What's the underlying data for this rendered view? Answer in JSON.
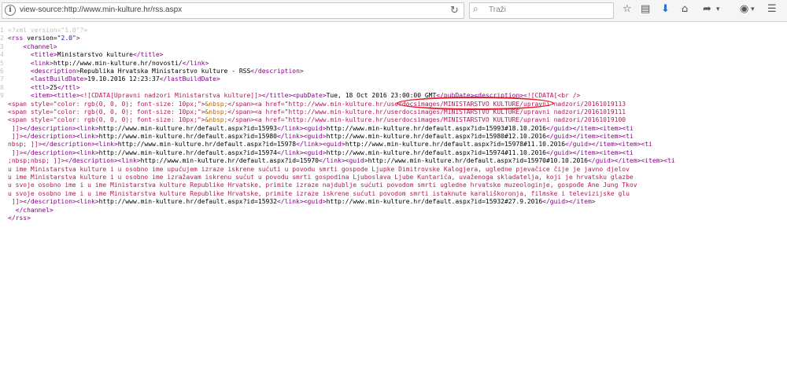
{
  "toolbar": {
    "url": "view-source:http://www.min-kulture.hr/rss.aspx",
    "search_placeholder": "Traži"
  },
  "source_lines": [
    [
      {
        "c": "pi",
        "t": "<?xml version=\"1.0\"?>"
      }
    ],
    [
      {
        "c": "tag",
        "t": "<rss "
      },
      {
        "c": "attr",
        "t": "version="
      },
      {
        "c": "av",
        "t": "\"2.0\""
      },
      {
        "c": "tag",
        "t": ">"
      }
    ],
    [
      {
        "c": "txt",
        "t": "    "
      },
      {
        "c": "tag",
        "t": "<channel>"
      }
    ],
    [
      {
        "c": "txt",
        "t": "      "
      },
      {
        "c": "tag",
        "t": "<title>"
      },
      {
        "c": "txt",
        "t": "Ministarstvo kulture"
      },
      {
        "c": "tag",
        "t": "</title>"
      }
    ],
    [
      {
        "c": "txt",
        "t": "      "
      },
      {
        "c": "tag",
        "t": "<link>"
      },
      {
        "c": "txt",
        "t": "http://www.min-kulture.hr/novosti/"
      },
      {
        "c": "tag",
        "t": "</link>"
      }
    ],
    [
      {
        "c": "txt",
        "t": "      "
      },
      {
        "c": "tag",
        "t": "<description>"
      },
      {
        "c": "txt",
        "t": "Republika Hrvatska Ministarstvo kulture - RSS"
      },
      {
        "c": "tag",
        "t": "</description>"
      }
    ],
    [
      {
        "c": "txt",
        "t": "      "
      },
      {
        "c": "tag",
        "t": "<lastBuildDate>"
      },
      {
        "c": "txt",
        "t": "19.10.2016 12:23:37"
      },
      {
        "c": "tag",
        "t": "</lastBuildDate>"
      }
    ],
    [
      {
        "c": "txt",
        "t": "      "
      },
      {
        "c": "tag",
        "t": "<ttl>"
      },
      {
        "c": "txt",
        "t": "25"
      },
      {
        "c": "tag",
        "t": "</ttl>"
      }
    ],
    [
      {
        "c": "txt",
        "t": "      "
      },
      {
        "c": "tag",
        "t": "<item><title>"
      },
      {
        "c": "cd",
        "t": "<![CDATA[Upravni nadzori Ministarstva kulture]]>"
      },
      {
        "c": "tag",
        "t": "</title><pubDate>"
      },
      {
        "c": "txt",
        "t": "Tue, 18 Oct 2016 23:00:00 GMT"
      },
      {
        "c": "tag",
        "t": "</pubDate><description>"
      },
      {
        "c": "cd",
        "t": "<![CDATA[<br />"
      }
    ],
    [
      {
        "c": "cd",
        "t": "<span style=\"color: rgb(0, 0, 0); font-size: 10px;\">"
      },
      {
        "c": "ent",
        "t": "&nbsp;"
      },
      {
        "c": "cd",
        "t": "</span><a href=\"http://www.min-kulture.hr/userdocsimages/MINISTARSTVO KULTURE/upravni nadzori/20161019113"
      }
    ],
    [
      {
        "c": "cd",
        "t": "<span style=\"color: rgb(0, 0, 0); font-size: 10px;\">"
      },
      {
        "c": "ent",
        "t": "&nbsp;"
      },
      {
        "c": "cd",
        "t": "</span><a href=\"http://www.min-kulture.hr/userdocsimages/MINISTARSTVO KULTURE/upravni nadzori/20161019111"
      }
    ],
    [
      {
        "c": "cd",
        "t": "<span style=\"color: rgb(0, 0, 0); font-size: 10px;\">"
      },
      {
        "c": "ent",
        "t": "&nbsp;"
      },
      {
        "c": "cd",
        "t": "</span><a href=\"http://www.min-kulture.hr/userdocsimages/MINISTARSTVO KULTURE/upravni nadzori/20161019100"
      }
    ],
    [
      {
        "c": "cd",
        "t": " ]]>"
      },
      {
        "c": "tag",
        "t": "</description><link>"
      },
      {
        "c": "txt",
        "t": "http://www.min-kulture.hr/default.aspx?id=15993"
      },
      {
        "c": "tag",
        "t": "</link><guid>"
      },
      {
        "c": "txt",
        "t": "http://www.min-kulture.hr/default.aspx?id=15993#18.10.2016"
      },
      {
        "c": "tag",
        "t": "</guid></item><item><ti"
      }
    ],
    [
      {
        "c": "cd",
        "t": " ]]>"
      },
      {
        "c": "tag",
        "t": "</description><link>"
      },
      {
        "c": "txt",
        "t": "http://www.min-kulture.hr/default.aspx?id=15980"
      },
      {
        "c": "tag",
        "t": "</link><guid>"
      },
      {
        "c": "txt",
        "t": "http://www.min-kulture.hr/default.aspx?id=15980#12.10.2016"
      },
      {
        "c": "tag",
        "t": "</guid></item><item><ti"
      }
    ],
    [
      {
        "c": "cd",
        "t": "nbsp; ]]>"
      },
      {
        "c": "tag",
        "t": "</description><link>"
      },
      {
        "c": "txt",
        "t": "http://www.min-kulture.hr/default.aspx?id=15978"
      },
      {
        "c": "tag",
        "t": "</link><guid>"
      },
      {
        "c": "txt",
        "t": "http://www.min-kulture.hr/default.aspx?id=15978#11.10.2016"
      },
      {
        "c": "tag",
        "t": "</guid></item><item><ti"
      }
    ],
    [
      {
        "c": "cd",
        "t": " ]]>"
      },
      {
        "c": "tag",
        "t": "</description><link>"
      },
      {
        "c": "txt",
        "t": "http://www.min-kulture.hr/default.aspx?id=15974"
      },
      {
        "c": "tag",
        "t": "</link><guid>"
      },
      {
        "c": "txt",
        "t": "http://www.min-kulture.hr/default.aspx?id=15974#11.10.2016"
      },
      {
        "c": "tag",
        "t": "</guid></item><item><ti"
      }
    ],
    [
      {
        "c": "cd",
        "t": ";nbsp;nbsp; ]]>"
      },
      {
        "c": "tag",
        "t": "</description><link>"
      },
      {
        "c": "txt",
        "t": "http://www.min-kulture.hr/default.aspx?id=15970"
      },
      {
        "c": "tag",
        "t": "</link><guid>"
      },
      {
        "c": "txt",
        "t": "http://www.min-kulture.hr/default.aspx?id=15970#10.10.2016"
      },
      {
        "c": "tag",
        "t": "</guid></item><item><ti"
      }
    ],
    [
      {
        "c": "cd",
        "t": "u ime Ministarstva kulture i u osobno ime upućujem izraze iskrene sućuti u povodu smrti gospode Ljupke Dimitrovske Kalogjera, ugledne pjevačice čije je javno djelov"
      }
    ],
    [
      {
        "c": "cd",
        "t": "u ime Ministarstva kulture i u osobno ime izražavam iskrenu sućut u povodu smrti gospodina Ljuboslava Ljube Kuntarića, uvaženoga skladatelja, koji je hrvatsku glazbe"
      }
    ],
    [
      {
        "c": "cd",
        "t": "u svoje osobno ime i u ime Ministarstva kulture Republike Hrvatske, primite izraze najdublje sućuti povodom smrti ugledne hrvatske muzeologinje, gospođe Ane Jung Tkov"
      }
    ],
    [
      {
        "c": "cd",
        "t": "u svoje osobno ime i u ime Ministarstva kulture Republike Hrvatske, primite izraze iskrene sućuti povodom smrti istaknute karališkoronja, filmske i televizijske glu"
      }
    ],
    [
      {
        "c": "cd",
        "t": " ]]>"
      },
      {
        "c": "tag",
        "t": "</description><link>"
      },
      {
        "c": "txt",
        "t": "http://www.min-kulture.hr/default.aspx?id=15932"
      },
      {
        "c": "tag",
        "t": "</link><guid>"
      },
      {
        "c": "txt",
        "t": "http://www.min-kulture.hr/default.aspx?id=15932#27.9.2016"
      },
      {
        "c": "tag",
        "t": "</guid></item>"
      }
    ],
    [
      {
        "c": "txt",
        "t": "  "
      },
      {
        "c": "tag",
        "t": "</channel>"
      }
    ],
    [
      {
        "c": "tag",
        "t": "</rss>"
      }
    ]
  ],
  "line_numbers": [
    "1",
    "2",
    "3",
    "4",
    "5",
    "6",
    "7",
    "8",
    "9",
    "",
    "",
    "",
    "",
    "",
    "",
    "",
    "",
    "",
    "",
    "",
    "",
    "",
    "",
    ""
  ]
}
